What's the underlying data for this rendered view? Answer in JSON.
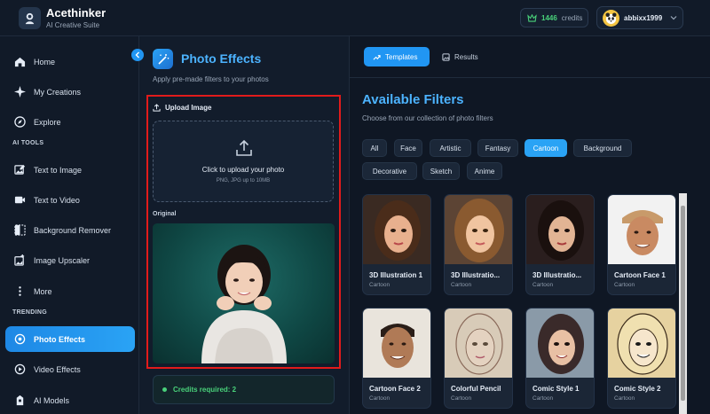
{
  "header": {
    "app_name": "Acethinker",
    "app_subtitle": "AI Creative Suite",
    "credits_count": "1446",
    "credits_label": "credits",
    "username": "abbixx1999"
  },
  "sidebar": {
    "items_top": [
      {
        "label": "Home",
        "icon": "home-icon"
      },
      {
        "label": "My Creations",
        "icon": "sparkle-icon"
      },
      {
        "label": "Explore",
        "icon": "compass-icon"
      }
    ],
    "section_ai_tools": "AI TOOLS",
    "items_tools": [
      {
        "label": "Text to Image",
        "icon": "image-edit-icon"
      },
      {
        "label": "Text to Video",
        "icon": "video-icon"
      },
      {
        "label": "Background Remover",
        "icon": "split-image-icon"
      },
      {
        "label": "Image Upscaler",
        "icon": "upscale-icon"
      },
      {
        "label": "More",
        "icon": "more-vertical-icon"
      }
    ],
    "section_trending": "TRENDING",
    "items_trending": [
      {
        "label": "Photo Effects",
        "icon": "photo-effects-icon",
        "active": true
      },
      {
        "label": "Video Effects",
        "icon": "video-effects-icon"
      },
      {
        "label": "AI Models",
        "icon": "ai-models-icon"
      }
    ]
  },
  "photo_effects": {
    "title": "Photo Effects",
    "subtitle": "Apply pre-made filters to your photos",
    "upload_title": "Upload Image",
    "dropzone_text": "Click to upload your photo",
    "dropzone_hint": "PNG, JPG up to 10MB",
    "original_label": "Original",
    "credits_required": "Credits required: 2"
  },
  "right": {
    "tabs": [
      {
        "label": "Templates",
        "active": true
      },
      {
        "label": "Results",
        "active": false
      }
    ],
    "title": "Available Filters",
    "subtitle": "Choose from our collection of photo filters",
    "chips": [
      "All",
      "Face",
      "Artistic",
      "Fantasy",
      "Cartoon",
      "Background",
      "Decorative",
      "Sketch",
      "Anime"
    ],
    "active_chip": "Cartoon",
    "cards": [
      {
        "name": "3D Illustration 1",
        "category": "Cartoon"
      },
      {
        "name": "3D Illustratio...",
        "category": "Cartoon"
      },
      {
        "name": "3D Illustratio...",
        "category": "Cartoon"
      },
      {
        "name": "Cartoon Face 1",
        "category": "Cartoon"
      },
      {
        "name": "Cartoon Face 2",
        "category": "Cartoon"
      },
      {
        "name": "Colorful Pencil",
        "category": "Cartoon"
      },
      {
        "name": "Comic Style 1",
        "category": "Cartoon"
      },
      {
        "name": "Comic Style 2",
        "category": "Cartoon"
      }
    ]
  },
  "colors": {
    "accent": "#2196f3",
    "title_blue": "#4cb3ff",
    "credit_green": "#49d17a",
    "highlight_red": "#e11b1b"
  }
}
